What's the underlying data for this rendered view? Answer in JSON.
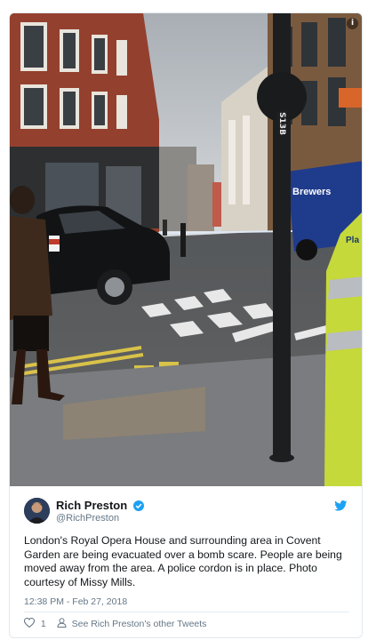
{
  "photo": {
    "description_icon": "info-icon",
    "pole_sign": "S13B",
    "van_text": "Brewers",
    "vest_text": "Pla"
  },
  "author": {
    "name": "Rich Preston",
    "handle": "@RichPreston",
    "verified": true
  },
  "tweet": {
    "text": "London's Royal Opera House and surrounding area in Covent Garden are being evacuated over a bomb scare.  People are being moved away from the area. A police cordon is in place. Photo courtesy of Missy Mills.",
    "timestamp": "12:38 PM - Feb 27, 2018"
  },
  "actions": {
    "like_count": "1",
    "see_more": "See Rich Preston's other Tweets"
  },
  "colors": {
    "twitter_blue": "#1da1f2",
    "muted": "#657786",
    "text": "#14171a"
  }
}
